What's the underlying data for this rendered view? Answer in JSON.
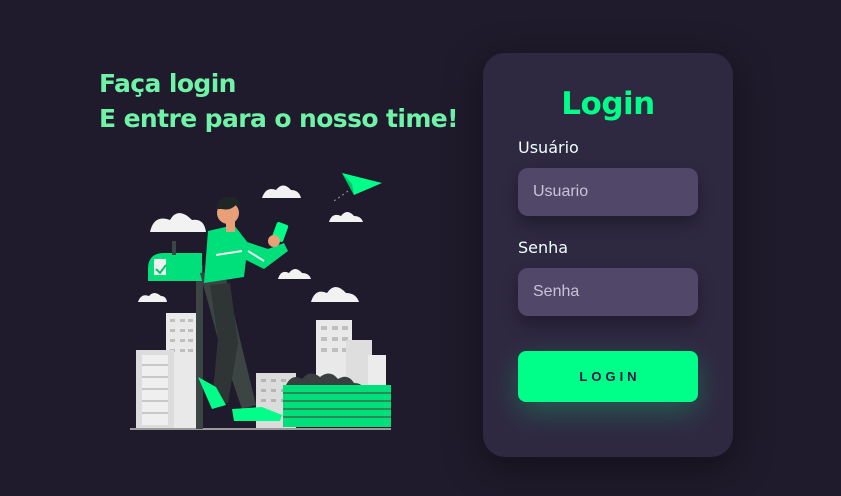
{
  "hero": {
    "line1": "Faça login",
    "line2": "E entre para o nosso time!"
  },
  "login_card": {
    "title": "Login",
    "username": {
      "label": "Usuário",
      "placeholder": "Usuario",
      "value": ""
    },
    "password": {
      "label": "Senha",
      "placeholder": "Senha",
      "value": ""
    },
    "submit_label": "LOGIN"
  },
  "colors": {
    "background": "#201b2c",
    "card": "#2f2841",
    "input": "#514869",
    "accent": "#00ff88",
    "headline": "#6ff4a7"
  },
  "illustration": {
    "name": "person-with-phone-city-illustration"
  }
}
